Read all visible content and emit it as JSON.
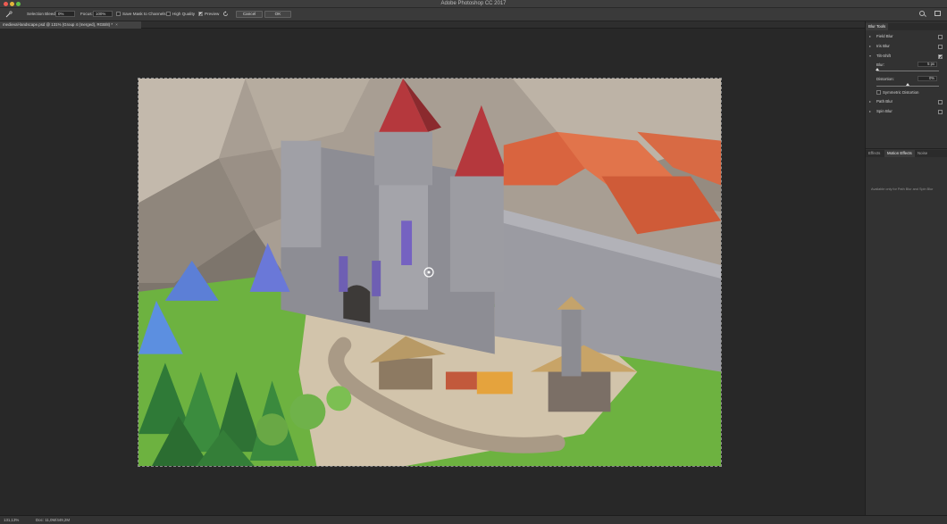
{
  "window": {
    "title": "Adobe Photoshop CC 2017"
  },
  "options_bar": {
    "selection_bleed_label": "Selection Bleed:",
    "selection_bleed_value": "0%",
    "focus_label": "Focus:",
    "focus_value": "100%",
    "save_mask_label": "Save Mask to Channels",
    "save_mask_checked": false,
    "high_quality_label": "High Quality",
    "high_quality_checked": false,
    "preview_label": "Preview",
    "preview_checked": true,
    "cancel_label": "Cancel",
    "ok_label": "OK"
  },
  "document": {
    "tab_label": "medieval-landscape.psd @ 131% (Group 4 (merged), RGB/8) *",
    "close_glyph": "×"
  },
  "status": {
    "zoom": "131,13%",
    "doc_info": "Doc: 11,0M/449,2M"
  },
  "blur_tools": {
    "title": "Blur Tools",
    "items": [
      {
        "label": "Field Blur",
        "checked": false,
        "expanded": false
      },
      {
        "label": "Iris Blur",
        "checked": false,
        "expanded": false
      },
      {
        "label": "Tilt-Shift",
        "checked": true,
        "expanded": true
      },
      {
        "label": "Path Blur",
        "checked": false,
        "expanded": false
      },
      {
        "label": "Spin Blur",
        "checked": false,
        "expanded": false
      }
    ],
    "tilt_shift": {
      "blur_label": "Blur:",
      "blur_value": "5 px",
      "blur_fraction": 0.02,
      "distortion_label": "Distortion:",
      "distortion_value": "0%",
      "distortion_fraction": 0.5,
      "symmetric_label": "Symmetric Distortion",
      "symmetric_checked": false
    }
  },
  "effects_panel": {
    "tabs": [
      "Effects",
      "Motion Effects",
      "Noise"
    ],
    "active_tab": "Motion Effects",
    "message": "Available only for Path Blur and Spin Blur"
  },
  "colors": {
    "accent_red": "#ec5b52",
    "accent_yellow": "#e3b53a",
    "accent_green": "#5fbf48",
    "panel_bg": "#323232",
    "canvas_bg": "#282828"
  }
}
